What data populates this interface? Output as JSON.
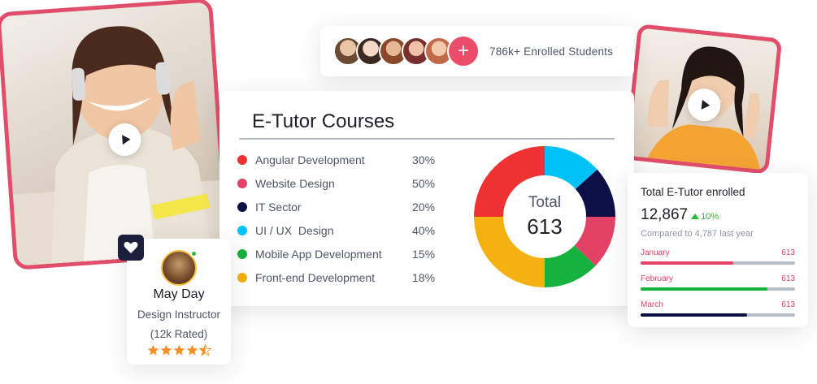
{
  "students": {
    "avatars": [
      "avatar-1",
      "avatar-2",
      "avatar-3",
      "avatar-4",
      "avatar-5"
    ],
    "avatar_colors": [
      "#c9a17a",
      "#f1d8c8",
      "#b5714a",
      "#8a3a3a",
      "#e8b49a"
    ],
    "plus_icon": "plus-icon",
    "label": "786k+ Enrolled Students"
  },
  "courses": {
    "title": "E-Tutor Courses",
    "items": [
      {
        "name": "Angular Development",
        "percent": "30%",
        "color": "#ee3232"
      },
      {
        "name": "Website Design",
        "percent": "50%",
        "color": "#e34266"
      },
      {
        "name": "IT Sector",
        "percent": "20%",
        "color": "#0d1045"
      },
      {
        "name": "UI / UX  Design",
        "percent": "40%",
        "color": "#00c2f6"
      },
      {
        "name": "Mobile App Development",
        "percent": "15%",
        "color": "#15b33d"
      },
      {
        "name": "Front-end Development",
        "percent": "18%",
        "color": "#f5b112"
      }
    ],
    "total_label": "Total",
    "total_value": "613"
  },
  "chart_data": {
    "type": "pie",
    "donut": true,
    "center_label": "Total",
    "center_value": "613",
    "slices": [
      {
        "color": "#00c2f6",
        "value": 40,
        "start_deg": 0,
        "end_deg": 48
      },
      {
        "color": "#0d1045",
        "value": 20,
        "start_deg": 48,
        "end_deg": 90
      },
      {
        "color": "#e34266",
        "value": 50,
        "start_deg": 90,
        "end_deg": 134
      },
      {
        "color": "#15b33d",
        "value": 15,
        "start_deg": 134,
        "end_deg": 180
      },
      {
        "color": "#f5b112",
        "value": 18,
        "start_deg": 180,
        "end_deg": 270
      },
      {
        "color": "#ee3232",
        "value": 30,
        "start_deg": 270,
        "end_deg": 360
      }
    ]
  },
  "instructor": {
    "name": "May Day",
    "role": "Design Instructor",
    "rating": "(12k Rated)",
    "stars": 4.5,
    "heart_icon": "heart-icon"
  },
  "enrolled": {
    "title": "Total E-Tutor enrolled",
    "value": "12,867",
    "delta": "10%",
    "subtitle": "Compared to 4,787 last year",
    "months": [
      {
        "label": "January",
        "value": "613",
        "fraction": 0.6,
        "color": "#e34266"
      },
      {
        "label": "February",
        "value": "613",
        "fraction": 0.82,
        "color": "#15b33d"
      },
      {
        "label": "March",
        "value": "613",
        "fraction": 0.69,
        "color": "#0d1045"
      }
    ]
  },
  "video": {
    "play_icon": "play-icon"
  }
}
